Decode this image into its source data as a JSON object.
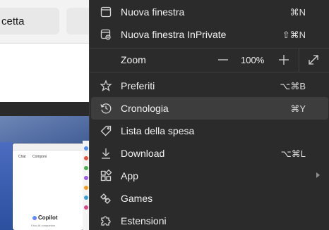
{
  "background": {
    "tab_text": "cetta",
    "thumbnail": {
      "tab1": "Chat",
      "tab2": "Componi",
      "logo": "Copilot",
      "tagline": "Il tuo AI companion"
    }
  },
  "menu": {
    "items": [
      {
        "label": "Nuova finestra",
        "shortcut": "⌘N",
        "icon": "window-icon"
      },
      {
        "label": "Nuova finestra InPrivate",
        "shortcut": "⇧⌘N",
        "icon": "inprivate-window-icon"
      },
      {
        "label": "Preferiti",
        "shortcut": "⌥⌘B",
        "icon": "favorites-star-icon"
      },
      {
        "label": "Cronologia",
        "shortcut": "⌘Y",
        "icon": "history-icon"
      },
      {
        "label": "Lista della spesa",
        "shortcut": "",
        "icon": "price-tag-icon"
      },
      {
        "label": "Download",
        "shortcut": "⌥⌘L",
        "icon": "download-icon"
      },
      {
        "label": "App",
        "shortcut": "",
        "icon": "apps-icon",
        "submenu": true
      },
      {
        "label": "Games",
        "shortcut": "",
        "icon": "games-icon"
      },
      {
        "label": "Estensioni",
        "shortcut": "",
        "icon": "extensions-puzzle-icon"
      }
    ],
    "zoom": {
      "label": "Zoom",
      "value": "100%"
    },
    "highlighted": "Cronologia"
  },
  "colors": {
    "menu_bg": "#2b2b2b",
    "highlight_bg": "#3d3d3d",
    "text": "#f2f2f2"
  }
}
